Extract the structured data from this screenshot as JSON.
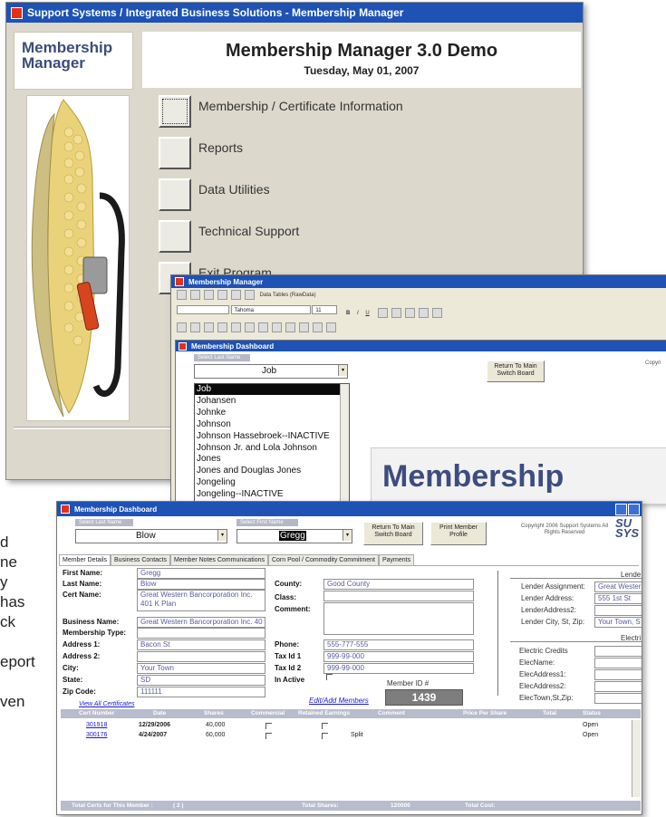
{
  "main_window": {
    "title": "Support Systems / Integrated Business Solutions - Membership Manager",
    "logo_text": "Membership Manager",
    "app_title": "Membership Manager 3.0 Demo",
    "date": "Tuesday, May 01, 2007",
    "menu": [
      "Membership / Certificate Information",
      "Reports",
      "Data Utilities",
      "Technical Support",
      "Exit Program"
    ]
  },
  "access_window": {
    "title": "Membership Manager",
    "toolbar_label": "Data Tables (RawData)",
    "font_name": "Tahoma",
    "font_size": "11"
  },
  "dashboard1": {
    "title": "Membership Dashboard",
    "select_label": "Select Last Name",
    "combo_value": "Job",
    "return_button": "Return To Main Switch Board",
    "copyright_partial": "Copyri",
    "list_items": [
      "Job",
      "Johansen",
      "Johnke",
      "Johnson",
      "Johnson Hassebroek--INACTIVE",
      "Johnson Jr. and Lola Johnson",
      "Jones",
      "Jones and Douglas Jones",
      "Jongeling",
      "Jongeling--INACTIVE"
    ],
    "logo_text": "Membership"
  },
  "dashboard2": {
    "title": "Membership Dashboard",
    "select_last_label": "Select Last Name",
    "select_first_label": "Select First Name",
    "last_name_value": "Blow",
    "first_name_value": "Gregg",
    "return_button": "Return To Main Switch Board",
    "print_button": "Print Member Profile",
    "copyright": "Copyright 2006 Support Systems All Rights Reserved",
    "logo_partial": "SU SYS",
    "tabs": [
      "Member Details",
      "Business Contacts",
      "Member Notes Communications",
      "Corn Pool / Commodity Commitment",
      "Payments"
    ],
    "left_fields": [
      {
        "label": "First Name:",
        "value": "Gregg"
      },
      {
        "label": "Last Name:",
        "value": "Blow"
      },
      {
        "label": "Cert Name:",
        "value": "Great Western Bancorporation Inc. 401 K Plan"
      },
      {
        "label": "Business Name:",
        "value": "Great Western Bancorporation Inc. 40"
      },
      {
        "label": "Membership Type:",
        "value": ""
      },
      {
        "label": "Address 1:",
        "value": "Bacon St"
      },
      {
        "label": "Address 2:",
        "value": ""
      },
      {
        "label": "City:",
        "value": "Your Town"
      },
      {
        "label": "State:",
        "value": "SD"
      },
      {
        "label": "Zip Code:",
        "value": "111111"
      }
    ],
    "mid_fields": [
      {
        "label": "County:",
        "value": "Good County"
      },
      {
        "label": "Class:",
        "value": ""
      },
      {
        "label": "Comment:",
        "value": ""
      },
      {
        "label": "Phone:",
        "value": "555-777-555"
      },
      {
        "label": "Tax Id 1",
        "value": "999-99-000"
      },
      {
        "label": "Tax Id 2",
        "value": "999-99-000"
      },
      {
        "label": "In Active",
        "value": ""
      }
    ],
    "member_id_label": "Member ID #",
    "member_id_value": "1439",
    "edit_members_link": "Edit/Add Members",
    "view_all_link": "View All Certificates",
    "lender_header": "Lende",
    "lender_fields": [
      {
        "label": "Lender Assignment:",
        "value": "Great Wester"
      },
      {
        "label": "Lender Address:",
        "value": "555 1st St"
      },
      {
        "label": "LenderAddress2:",
        "value": ""
      },
      {
        "label": "Lender City, St, Zip:",
        "value": "Your Town, S"
      }
    ],
    "electric_header": "Electri",
    "electric_fields": [
      "Electric Credits",
      "ElecName:",
      "ElecAddress1:",
      "ElecAddress2:",
      "ElecTown,St,Zip:"
    ],
    "cert_headers": [
      "Cert Number",
      "Date",
      "Shares",
      "Commercial",
      "Retained Earnings",
      "Comment",
      "Price Per Share",
      "Total",
      "Status"
    ],
    "cert_rows": [
      {
        "cert": "301918",
        "date": "12/29/2006",
        "shares": "40,000",
        "comment": "",
        "status": "Open"
      },
      {
        "cert": "300176",
        "date": "4/24/2007",
        "shares": "60,000",
        "comment": "Split",
        "status": "Open"
      }
    ],
    "footer_total_certs_label": "Total Certs for This Member :",
    "footer_total_certs_value": "( 2 )",
    "footer_total_shares_label": "Total Shares:",
    "footer_total_shares_value": "120000",
    "footer_total_cost_label": "Total Cost:"
  },
  "background_text": [
    "d",
    "ne",
    "y",
    "has",
    "ck",
    "eport",
    "ven"
  ]
}
